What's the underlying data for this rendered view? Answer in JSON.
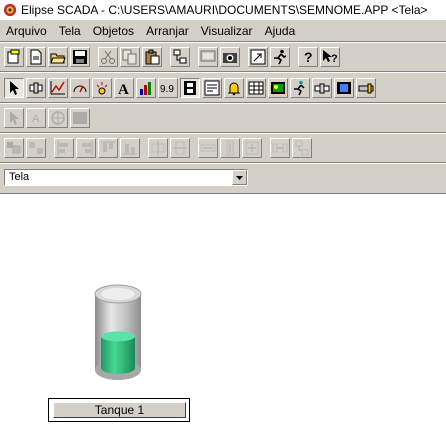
{
  "window": {
    "title": "Elipse SCADA - C:\\USERS\\AMAURI\\DOCUMENTS\\SEMNOME.APP <Tela>"
  },
  "menu": [
    "Arquivo",
    "Tela",
    "Objetos",
    "Arranjar",
    "Visualizar",
    "Ajuda"
  ],
  "toolbar1": [
    "new-icon",
    "new-doc-icon",
    "open-icon",
    "save-icon",
    "cut-icon",
    "copy-icon",
    "paste-icon",
    "app-browser-icon",
    "screen-icon",
    "camera-icon",
    "run-icon",
    "runner-icon",
    "help-icon",
    "context-help-icon"
  ],
  "toolbar2": [
    "select-arrow-icon",
    "setpoint-icon",
    "trend-icon",
    "gauge-icon",
    "alarm-display-icon",
    "text-icon",
    "bar-chart-icon",
    "numeric-display-icon",
    "film-icon",
    "browser-icon",
    "bell-icon",
    "table-icon",
    "report-icon",
    "animation-icon",
    "slider-icon",
    "video-icon",
    "pipe-icon"
  ],
  "toolbar2_digits": "9.9",
  "toolbar2_letter": "A",
  "screen_selector": {
    "value": "Tela"
  },
  "tank": {
    "label": "Tanque 1",
    "level": 0.48,
    "liquid_color": "#2db87a"
  }
}
